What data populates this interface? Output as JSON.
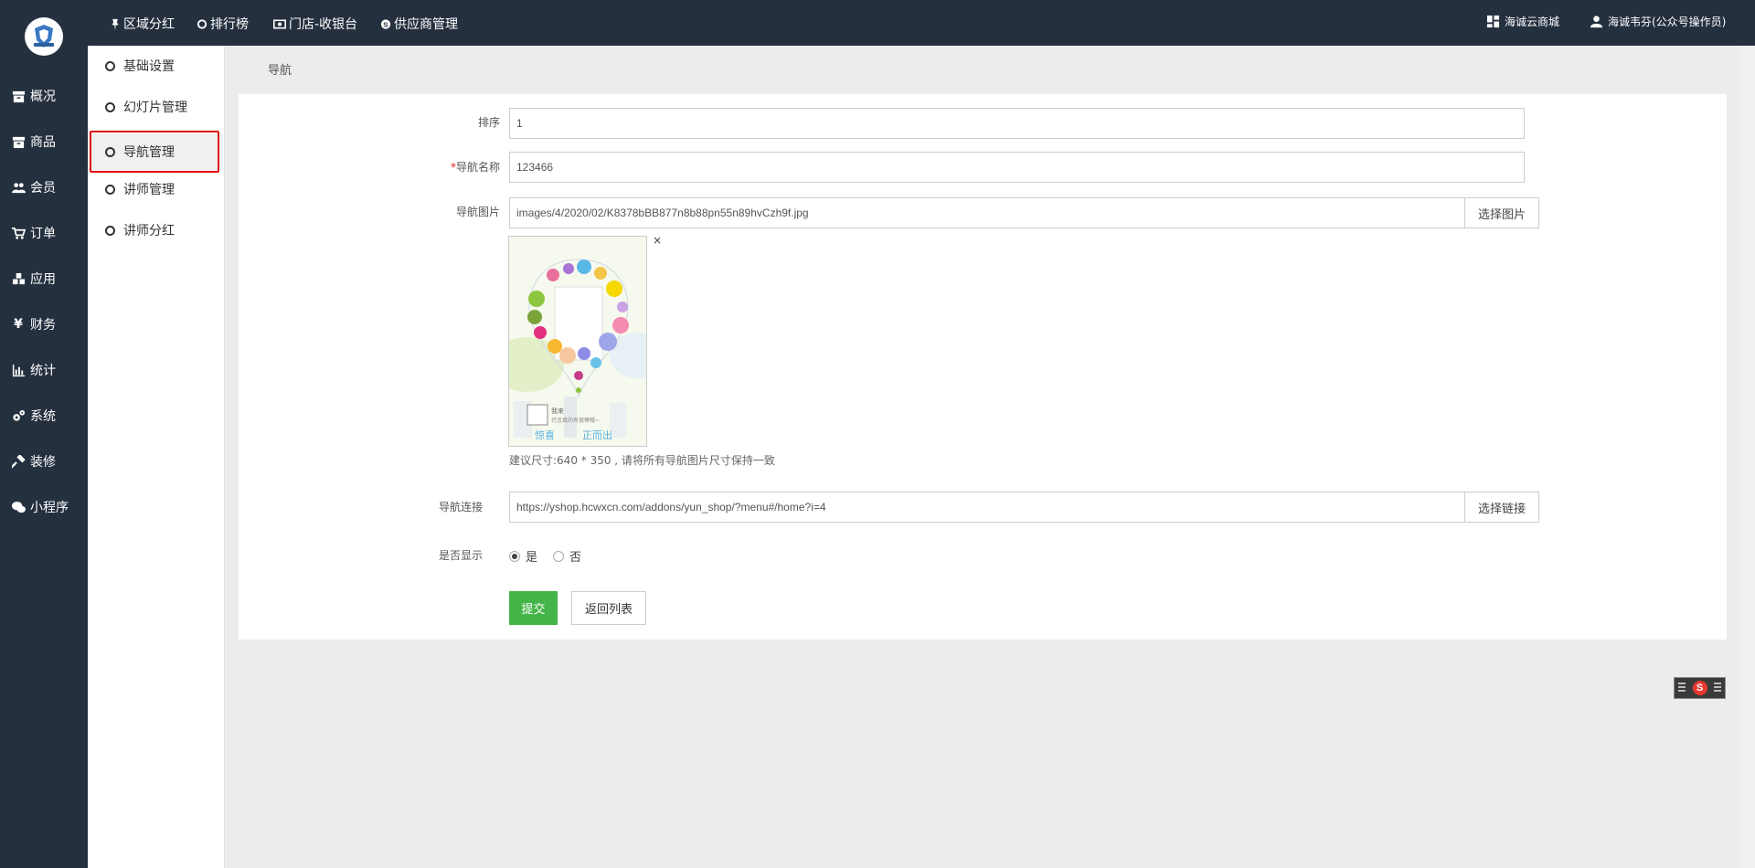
{
  "topbar": {
    "links": [
      {
        "label": "区域分红",
        "icon": "pin-icon"
      },
      {
        "label": "排行榜",
        "icon": "circle-icon"
      },
      {
        "label": "门店-收银台",
        "icon": "cash-register-icon"
      },
      {
        "label": "供应商管理",
        "icon": "skype-icon"
      }
    ],
    "right": [
      {
        "label": "海诚云商城",
        "icon": "grid-icon"
      },
      {
        "label": "海诚韦芬(公众号操作员)",
        "icon": "user-icon"
      }
    ]
  },
  "sidebar": {
    "items": [
      {
        "label": "概况",
        "icon": "archive-icon"
      },
      {
        "label": "商品",
        "icon": "box-icon"
      },
      {
        "label": "会员",
        "icon": "users-icon"
      },
      {
        "label": "订单",
        "icon": "cart-icon"
      },
      {
        "label": "应用",
        "icon": "cubes-icon"
      },
      {
        "label": "财务",
        "icon": "yen-icon"
      },
      {
        "label": "统计",
        "icon": "bar-chart-icon"
      },
      {
        "label": "系统",
        "icon": "cogs-icon"
      },
      {
        "label": "装修",
        "icon": "hammer-icon"
      },
      {
        "label": "小程序",
        "icon": "wechat-icon"
      }
    ]
  },
  "subnav": {
    "items": [
      {
        "label": "基础设置"
      },
      {
        "label": "幻灯片管理"
      },
      {
        "label": "导航管理",
        "active": true
      },
      {
        "label": "讲师管理"
      },
      {
        "label": "讲师分红"
      }
    ]
  },
  "breadcrumb": "导航",
  "form": {
    "sort": {
      "label": "排序",
      "value": "1"
    },
    "name": {
      "required_mark": "*",
      "label": "导航名称",
      "value": "123466"
    },
    "image": {
      "label": "导航图片",
      "value": "images/4/2020/02/K8378bBB877n8b88pn55n89hvCzh9f.jpg",
      "button": "选择图片",
      "remove": "×"
    },
    "hint": "建议尺寸:640 * 350 , 请将所有导航图片尺寸保持一致",
    "link": {
      "label": "导航连接",
      "value": "https://yshop.hcwxcn.com/addons/yun_shop/?menu#/home?i=4",
      "button": "选择链接"
    },
    "display": {
      "label": "是否显示",
      "options": [
        {
          "label": "是",
          "checked": true
        },
        {
          "label": "否",
          "checked": false
        }
      ]
    },
    "submit": "提交",
    "back": "返回列表"
  }
}
